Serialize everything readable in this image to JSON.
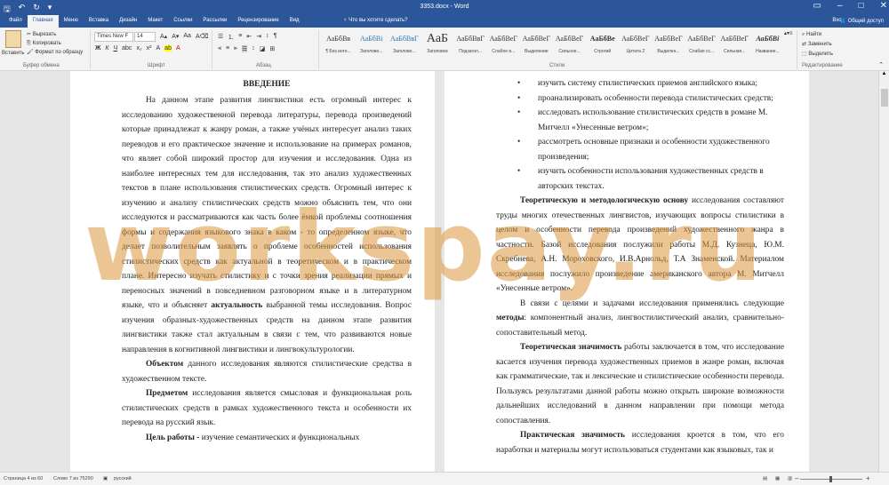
{
  "titlebar": {
    "save_icon": "save-icon",
    "undo_icon": "undo-icon",
    "redo_icon": "redo-icon",
    "customize_icon": "customize-qat-icon",
    "doc_title": "3353.docx - Word"
  },
  "tabs": [
    "Файл",
    "Главная",
    "Меню",
    "Вставка",
    "Дизайн",
    "Макет",
    "Ссылки",
    "Рассылки",
    "Рецензирование",
    "Вид"
  ],
  "active_tab": "Главная",
  "tell_me": "Что вы хотите сделать?",
  "login": "Вход",
  "share": "Общий доступ",
  "clipboard": {
    "paste": "Вставить",
    "cut": "Вырезать",
    "copy": "Копировать",
    "format_painter": "Формат по образцу",
    "label": "Буфер обмена"
  },
  "font": {
    "name": "Times New F",
    "size": "14",
    "label": "Шрифт"
  },
  "paragraph": {
    "label": "Абзац"
  },
  "styles": {
    "label": "Стили",
    "items": [
      {
        "sample": "АаБбВв",
        "name": "¶ Без инте..."
      },
      {
        "sample": "АаБбВі",
        "name": "Заголово..."
      },
      {
        "sample": "АаБбВвГ",
        "name": "Заголово..."
      },
      {
        "sample": "АаБ",
        "name": "Заголовок"
      },
      {
        "sample": "АаБбВвГ",
        "name": "Подзагол..."
      },
      {
        "sample": "АаБбВеГ",
        "name": "Слабое в..."
      },
      {
        "sample": "АаБбВеГ",
        "name": "Выделение"
      },
      {
        "sample": "АаБбВеГ",
        "name": "Сильное..."
      },
      {
        "sample": "АаБбВе",
        "name": "Строгий"
      },
      {
        "sample": "АаБбВеГ",
        "name": "Цитата 2"
      },
      {
        "sample": "АаБбВеГ",
        "name": "Выделен..."
      },
      {
        "sample": "АаБбВеГ",
        "name": "Слабая сс..."
      },
      {
        "sample": "АаБбВеГ",
        "name": "Сильная..."
      },
      {
        "sample": "АаБбВі",
        "name": "Название..."
      }
    ]
  },
  "editing": {
    "find": "Найти",
    "replace": "Заменить",
    "select": "Выделить",
    "label": "Редактирование"
  },
  "left_page": {
    "heading": "ВВЕДЕНИЕ",
    "p1": "На данном этапе развития лингвистики есть огромный интерес к исследованию художественной перевода литературы, перевода произведений которые принадлежат к жанру роман, а также учёных интересует анализ таких переводов и его практическое значение и использование на примерах романов, что являет собой широкий простор для изучения и исследования. Одна из наиболее интересных тем для исследования, так это анализ художественных текстов в плане использования стилистических средств. Огромный интерес к изучению и анализу стилистических средств можно объяснить тем, что они исследуются и рассматриваются как часть более ёмкой проблемы соотношения формы и содержания языкового знака в каком - то определенном языке, что делает позволительным заявлять о проблеме особенностей использования стилистических средств как актуальной в теоретическом и в практическом плане. Интересно изучать стилистику и с точки зрения реализации прямых и переносных значений в повседневном разговорном языке и в литературном языке, что и объясняет",
    "p1_bold": "актуальность",
    "p1_end": "выбранной темы исследования. Вопрос изучения образных-художественных средств на данном этапе развития лингвистики также стал актуальным в связи с тем, что развиваются новые направления в когнитивной лингвистики и лингвокультурологии.",
    "p2_bold": "Объектом",
    "p2": "данного исследования являются стилистические средства в художественном тексте.",
    "p3_bold": "Предметом",
    "p3": "исследования является смысловая и функциональная роль стилистических средств в рамках художественного текста и особенности их перевода на русский язык.",
    "p4_bold": "Цель работы -",
    "p4": "изучение семантических и функциональных"
  },
  "right_page": {
    "bullets": [
      "изучить систему стилистических приемов английского языка;",
      "проанализировать особенности перевода стилистических средств;",
      "исследовать использование стилистических средств в романе М. Митчелл «Унесенные ветром»;",
      "рассмотреть основные признаки и особенности художественного произведения;",
      "изучить особенности использования художественных средств в авторских текстах."
    ],
    "p1_bold": "Теоретическую и методологическую основу",
    "p1": "исследования составляют труды многих отечественных лингвистов, изучающих вопросы стилистики в целом и особенности перевода произведений художественного жанра в частности. Базой исследования послужили работы М.Д. Кузнеца, Ю.М. Скребнева, А.Н. Мороховского, И.В.Арнольд, Т.А Знаменской. Материалом исследования послужило произведение американского автора М. Митчелл «Унесенные ветром».",
    "p2_start": "В связи с целями и задачами исследования применялись следующие",
    "p2_bold": "методы",
    "p2": ": компонентный анализ, лингвостилистический анализ, сравнительно-сопоставительный метод.",
    "p3_bold": "Теоретическая значимость",
    "p3": "работы заключается в том, что исследование касается изучения перевода художественных приемов в жанре роман, включая как грамматические, так и лексические и стилистические особенности перевода. Пользуясь результатами данной работы можно открыть широкие возможности дальнейших исследований в данном направлении при помощи метода сопоставления.",
    "p4_bold": "Практическая значимость",
    "p4": "исследования кроется в том, что его наработки и материалы могут использоваться студентами как языковых, так и"
  },
  "watermark": "workspay.ru",
  "status": {
    "page": "Страница 4 из 60",
    "words": "Слово 7 из 75290",
    "lang": "русский",
    "zoom": "+"
  },
  "colors": {
    "accent": "#2b579a",
    "watermark": "#da963c"
  }
}
